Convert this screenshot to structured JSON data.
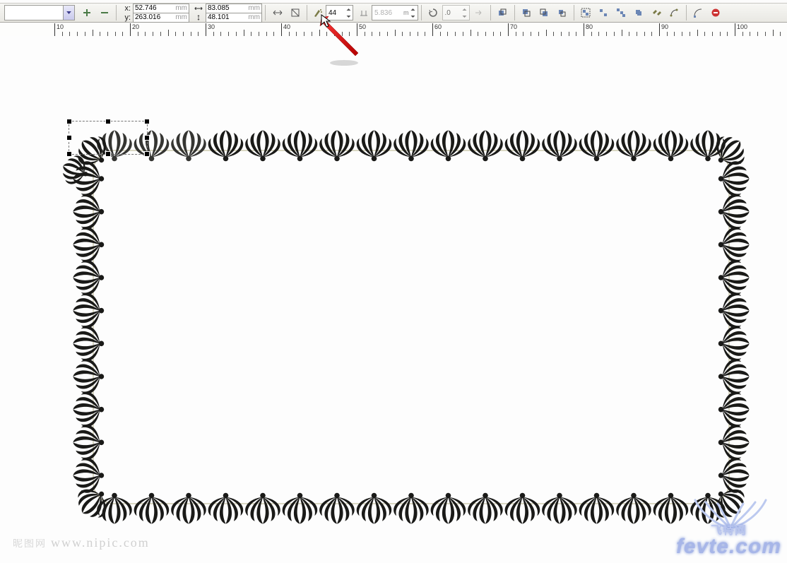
{
  "toolbar": {
    "x_label": "x:",
    "y_label": "y:",
    "x_value": "52.746",
    "y_value": "263.016",
    "unit": "mm",
    "width_value": "83.085",
    "height_value": "48.101",
    "copies_value": "44",
    "spacing_value": "5.836",
    "angle_value": ".0"
  },
  "ruler": {
    "majors": [
      "10",
      "20",
      "30",
      "40",
      "50",
      "60",
      "70",
      "80",
      "90",
      "100"
    ]
  },
  "watermarks": {
    "nipic_cn": "昵图网",
    "nipic_url": "www.nipic.com",
    "fevte_cn": "飞特网",
    "fevte_url": "fevte.com"
  }
}
